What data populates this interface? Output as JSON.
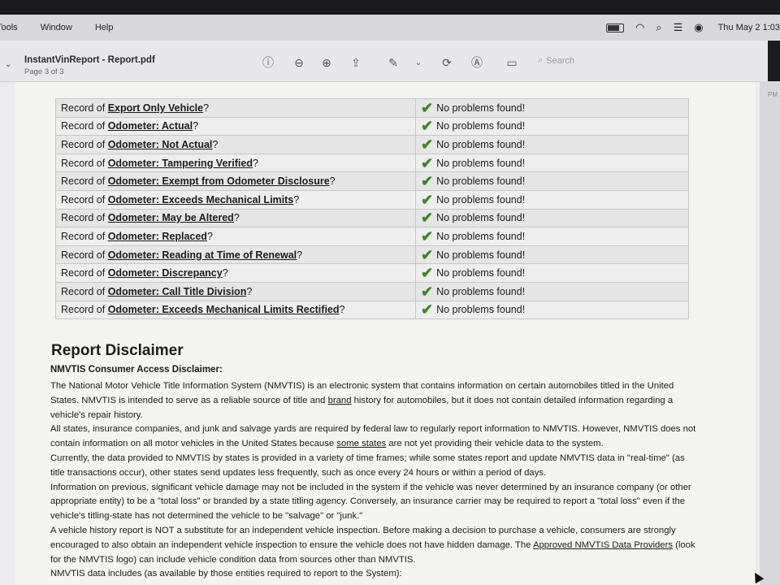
{
  "menubar": {
    "items": [
      "Tools",
      "Window",
      "Help"
    ],
    "clock": "Thu May 2  1:03"
  },
  "toolbar": {
    "doc_title": "InstantVinReport - Report.pdf",
    "page_indicator": "Page 3 of 3",
    "search_placeholder": "Search"
  },
  "rightstrip": {
    "label": "PM"
  },
  "checks": [
    {
      "prefix": "Record of",
      "field": "Export Only Vehicle",
      "suffix": "?",
      "result": "No problems found!"
    },
    {
      "prefix": "Record of",
      "field": "Odometer: Actual",
      "suffix": "?",
      "result": "No problems found!"
    },
    {
      "prefix": "Record of",
      "field": "Odometer: Not Actual",
      "suffix": "?",
      "result": "No problems found!"
    },
    {
      "prefix": "Record of",
      "field": "Odometer: Tampering Verified",
      "suffix": "?",
      "result": "No problems found!"
    },
    {
      "prefix": "Record of",
      "field": "Odometer: Exempt from Odometer Disclosure",
      "suffix": "?",
      "result": "No problems found!"
    },
    {
      "prefix": "Record of",
      "field": "Odometer: Exceeds Mechanical Limits",
      "suffix": "?",
      "result": "No problems found!"
    },
    {
      "prefix": "Record of",
      "field": "Odometer: May be Altered",
      "suffix": "?",
      "result": "No problems found!"
    },
    {
      "prefix": "Record of",
      "field": "Odometer: Replaced",
      "suffix": "?",
      "result": "No problems found!"
    },
    {
      "prefix": "Record of",
      "field": "Odometer: Reading at Time of Renewal",
      "suffix": "?",
      "result": "No problems found!"
    },
    {
      "prefix": "Record of",
      "field": "Odometer: Discrepancy",
      "suffix": "?",
      "result": "No problems found!"
    },
    {
      "prefix": "Record of",
      "field": "Odometer: Call Title Division",
      "suffix": "?",
      "result": "No problems found!"
    },
    {
      "prefix": "Record of",
      "field": "Odometer: Exceeds Mechanical Limits Rectified",
      "suffix": "?",
      "result": "No problems found!"
    }
  ],
  "disclaimer": {
    "heading": "Report Disclaimer",
    "subheading": "NMVTIS Consumer Access Disclaimer:",
    "p1_a": "The National Motor Vehicle Title Information System (NMVTIS) is an electronic system that contains information on certain automobiles titled in the United States. NMVTIS is intended to serve as a reliable source of title and ",
    "p1_link": "brand",
    "p1_b": " history for automobiles, but it does not contain detailed information regarding a vehicle's repair history.",
    "p2_a": "All states, insurance companies, and junk and salvage yards are required by federal law to regularly report information to NMVTIS. However, NMVTIS does not contain information on all motor vehicles in the United States because ",
    "p2_link": "some states",
    "p2_b": " are not yet providing their vehicle data to the system.",
    "p3": "Currently, the data provided to NMVTIS by states is provided in a variety of time frames; while some states report and update NMVTIS data in \"real-time\" (as title transactions occur), other states send updates less frequently, such as once every 24 hours or within a period of days.",
    "p4": "Information on previous, significant vehicle damage may not be included in the system if the vehicle was never determined by an insurance company (or other appropriate entity) to be a \"total loss\" or branded by a state titling agency. Conversely, an insurance carrier may be required to report a \"total loss\" even if the vehicle's titling-state has not determined the vehicle to be \"salvage\" or \"junk.\"",
    "p5_a": "A vehicle history report is NOT a substitute for an independent vehicle inspection. Before making a decision to purchase a vehicle, consumers are strongly encouraged to also obtain an independent vehicle inspection to ensure the vehicle does not have hidden damage. The ",
    "p5_link": "Approved NMVTIS Data Providers",
    "p5_b": " (look for the NMVTIS logo) can include vehicle condition data from sources other than NMVTIS.",
    "p6": "NMVTIS data includes (as available by those entities required to report to the System):"
  }
}
